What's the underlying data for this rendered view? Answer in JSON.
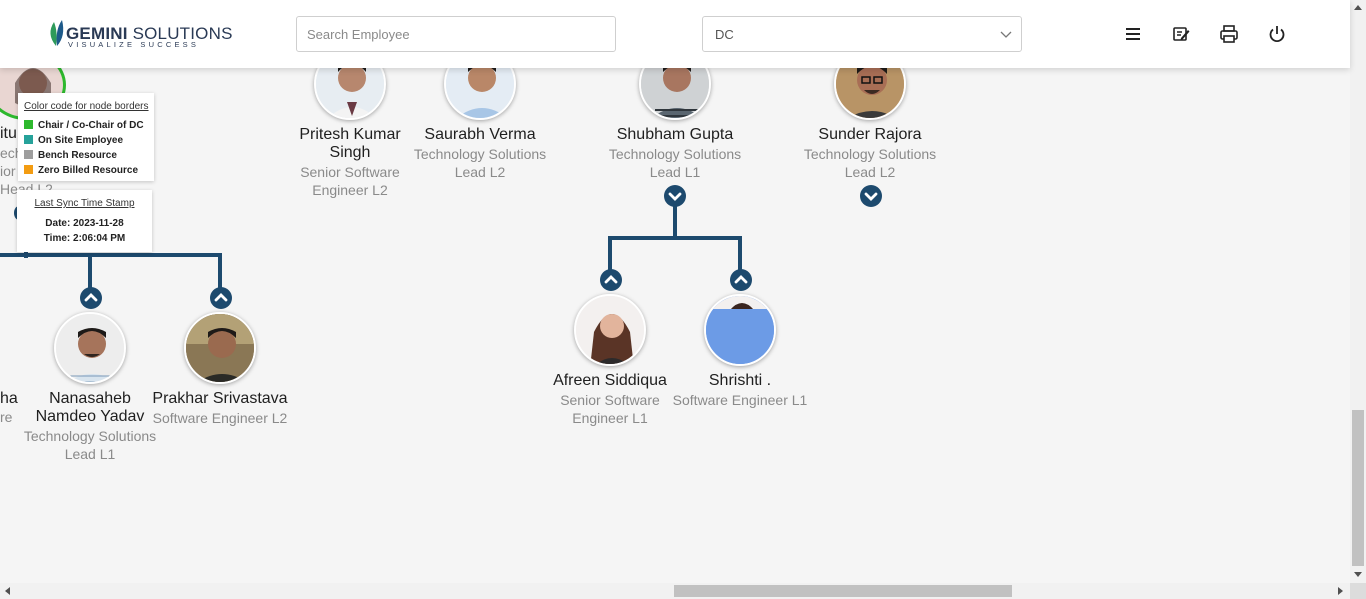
{
  "header": {
    "logo": {
      "name_bold": "GEMINI",
      "name_rest": " SOLUTIONS",
      "tagline": "VISUALIZE SUCCESS"
    },
    "search": {
      "placeholder": "Search Employee",
      "value": ""
    },
    "department_select": {
      "value": "DC"
    },
    "icons": [
      "menu-icon",
      "edit-note-icon",
      "print-icon",
      "power-icon"
    ]
  },
  "legend": {
    "title": "Color code for node borders",
    "items": [
      {
        "label": "Chair / Co-Chair of DC",
        "color": "#2db82d"
      },
      {
        "label": "On Site Employee",
        "color": "#26a29a"
      },
      {
        "label": "Bench Resource",
        "color": "#9e9e9e"
      },
      {
        "label": "Zero Billed Resource",
        "color": "#f39c12"
      }
    ]
  },
  "sync": {
    "title": "Last Sync Time Stamp",
    "date": "Date: 2023-11-28",
    "time": "Time: 2:06:04 PM"
  },
  "partial_left": {
    "name_fragment": "itu",
    "role_fragments": [
      "ech",
      "ior",
      "Head L2"
    ],
    "bottom_name_fragment": "ha",
    "bottom_role_fragment": "re"
  },
  "employees": [
    {
      "name": "Pritesh Kumar Singh",
      "role": "Senior Software Engineer L2"
    },
    {
      "name": "Saurabh Verma",
      "role": "Technology Solutions Lead L2"
    },
    {
      "name": "Shubham Gupta",
      "role": "Technology Solutions Lead L1"
    },
    {
      "name": "Sunder Rajora",
      "role": "Technology Solutions Lead L2"
    },
    {
      "name": "Nanasaheb Namdeo Yadav",
      "role": "Technology Solutions Lead L1"
    },
    {
      "name": "Prakhar Srivastava",
      "role": "Software Engineer L2"
    },
    {
      "name": "Afreen Siddiqua",
      "role": "Senior Software Engineer L1"
    },
    {
      "name": "Shrishti .",
      "role": "Software Engineer L1"
    }
  ],
  "colors": {
    "connector": "#1d4a6e",
    "placeholder_avatar": "#6c9be6"
  }
}
